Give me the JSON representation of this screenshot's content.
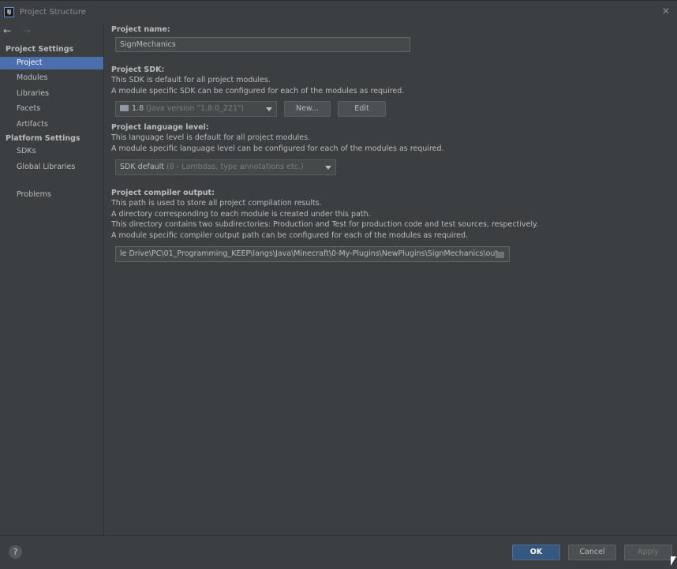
{
  "window": {
    "title": "Project Structure",
    "logo_text": "IJ",
    "close_glyph": "✕"
  },
  "nav": {
    "back": "←",
    "forward": "→"
  },
  "sidebar": {
    "project_settings_header": "Project Settings",
    "project_settings_items": [
      {
        "label": "Project",
        "selected": true
      },
      {
        "label": "Modules"
      },
      {
        "label": "Libraries"
      },
      {
        "label": "Facets"
      },
      {
        "label": "Artifacts"
      }
    ],
    "platform_settings_header": "Platform Settings",
    "platform_settings_items": [
      {
        "label": "SDKs"
      },
      {
        "label": "Global Libraries"
      }
    ],
    "problems": "Problems"
  },
  "project_name": {
    "label": "Project name:",
    "value": "SignMechanics"
  },
  "project_sdk": {
    "label": "Project SDK:",
    "desc1": "This SDK is default for all project modules.",
    "desc2": "A module specific SDK can be configured for each of the modules as required.",
    "selected": "1.8",
    "selected_detail": "(java version \"1.8.0_221\")",
    "new_button": "New...",
    "edit_button": "Edit"
  },
  "language_level": {
    "label": "Project language level:",
    "desc1": "This language level is default for all project modules.",
    "desc2": "A module specific language level can be configured for each of the modules as required.",
    "selected": "SDK default",
    "selected_detail": "(8 - Lambdas, type annotations etc.)"
  },
  "compiler_output": {
    "label": "Project compiler output:",
    "desc1": "This path is used to store all project compilation results.",
    "desc2": "A directory corresponding to each module is created under this path.",
    "desc3": "This directory contains two subdirectories: Production and Test for production code and test sources, respectively.",
    "desc4": "A module specific compiler output path can be configured for each of the modules as required.",
    "path": "le Drive\\PC\\01_Programming_KEEP\\langs\\Java\\Minecraft\\0-My-Plugins\\NewPlugins\\SignMechanics\\out"
  },
  "footer": {
    "help": "?",
    "ok": "OK",
    "cancel": "Cancel",
    "apply": "Apply"
  },
  "colors": {
    "background": "#3c3f41",
    "selection": "#4b6eaf",
    "ok_button": "#365880"
  }
}
